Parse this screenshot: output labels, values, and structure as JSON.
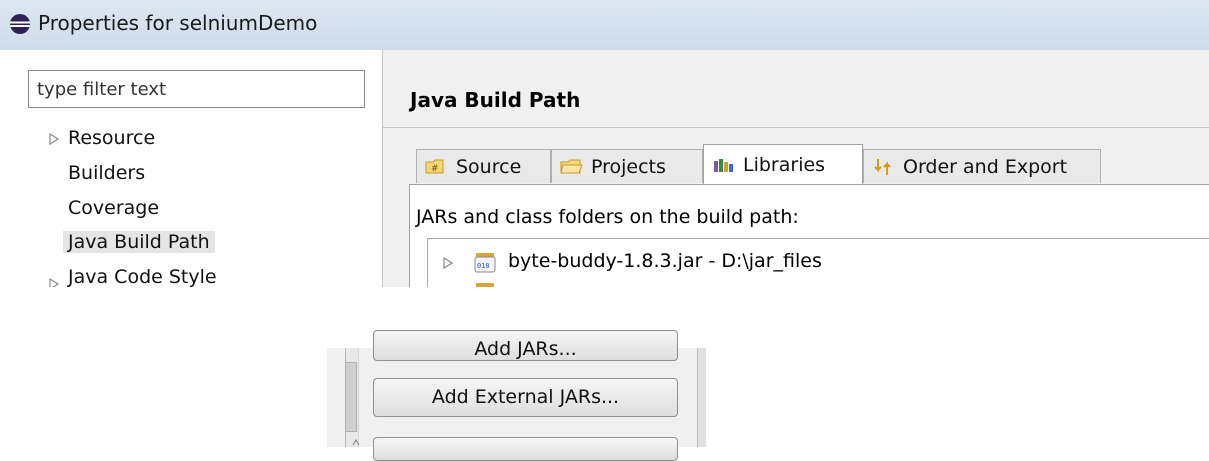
{
  "window": {
    "title": "Properties for selniumDemo",
    "title_icon": "eclipse-icon"
  },
  "sidebar": {
    "filter_placeholder": "type filter text",
    "items": [
      {
        "label": "Resource",
        "expandable": true
      },
      {
        "label": "Builders",
        "expandable": false
      },
      {
        "label": "Coverage",
        "expandable": false
      },
      {
        "label": "Java Build Path",
        "expandable": false,
        "selected": true
      },
      {
        "label": "Java Code Style",
        "expandable": true
      }
    ]
  },
  "main": {
    "page_title": "Java Build Path",
    "tabs": [
      {
        "label": "Source",
        "icon": "source-folder-icon"
      },
      {
        "label": "Projects",
        "icon": "projects-folder-icon"
      },
      {
        "label": "Libraries",
        "icon": "libraries-icon",
        "active": true
      },
      {
        "label": "Order and Export",
        "icon": "order-export-icon"
      }
    ],
    "panel_label": "JARs and class folders on the build path:",
    "jars": [
      {
        "label": "byte-buddy-1.8.3.jar - D:\\jar_files",
        "icon": "jar-icon"
      }
    ]
  },
  "buttons": {
    "add_jars": "Add JARs...",
    "add_external_jars": "Add External JARs..."
  },
  "colors": {
    "titlebar": "#cfdcea",
    "panel_bg": "#f0f0f0",
    "selection": "#e5e5e5"
  }
}
